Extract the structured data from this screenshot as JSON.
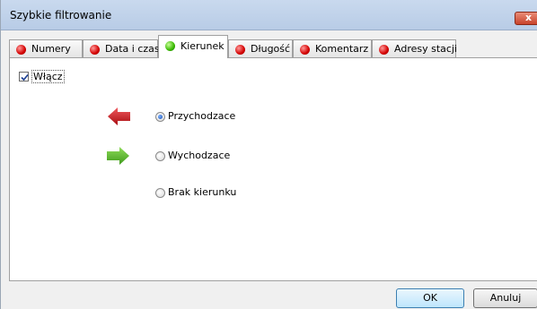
{
  "window": {
    "title": "Szybkie filtrowanie",
    "close_glyph": "x"
  },
  "tabs": [
    {
      "label": "Numery",
      "status": "red"
    },
    {
      "label": "Data i czas",
      "status": "red"
    },
    {
      "label": "Kierunek",
      "status": "green",
      "active": true
    },
    {
      "label": "Długość",
      "status": "red"
    },
    {
      "label": "Komentarz",
      "status": "red"
    },
    {
      "label": "Adresy stacji",
      "status": "red"
    }
  ],
  "panel": {
    "enable_checkbox": {
      "label": "Włącz",
      "checked": true
    },
    "direction_options": [
      {
        "label": "Przychodzace",
        "selected": true,
        "icon": "arrow-left-red-icon"
      },
      {
        "label": "Wychodzace",
        "selected": false,
        "icon": "arrow-right-green-icon"
      },
      {
        "label": "Brak kierunku",
        "selected": false,
        "icon": "none"
      }
    ]
  },
  "buttons": {
    "ok": "OK",
    "cancel": "Anuluj"
  },
  "colors": {
    "incoming_arrow": "#c8161d",
    "outgoing_arrow": "#5cb82e",
    "title_bar": "#c3d5ec"
  }
}
